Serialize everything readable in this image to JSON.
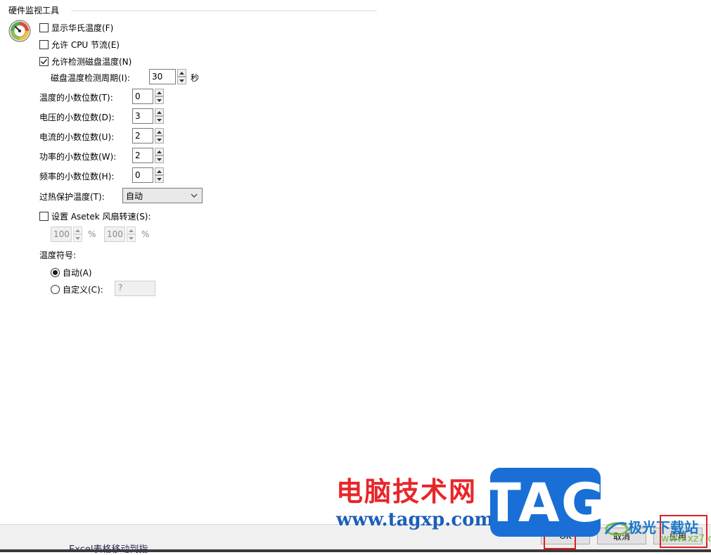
{
  "section": {
    "title": "硬件监视工具"
  },
  "options": {
    "fahrenheit": {
      "label": "显示华氏温度(F)",
      "checked": false
    },
    "cpu_throttle": {
      "label": "允许 CPU 节流(E)",
      "checked": false
    },
    "disk_temp": {
      "label": "允许检测磁盘温度(N)",
      "checked": true
    }
  },
  "disk_period": {
    "label": "磁盘温度检测周期(I):",
    "value": "30",
    "unit": "秒"
  },
  "decimals": [
    {
      "label": "温度的小数位数(T):",
      "value": "0"
    },
    {
      "label": "电压的小数位数(D):",
      "value": "3"
    },
    {
      "label": "电流的小数位数(U):",
      "value": "2"
    },
    {
      "label": "功率的小数位数(W):",
      "value": "2"
    },
    {
      "label": "频率的小数位数(H):",
      "value": "0"
    }
  ],
  "overheat": {
    "label": "过热保护温度(T):",
    "selected": "自动"
  },
  "asetek": {
    "label": "设置 Asetek 风扇转速(S):",
    "checked": false,
    "fan1": {
      "value": "100",
      "unit": "%"
    },
    "fan2": {
      "value": "100",
      "unit": "%"
    }
  },
  "temp_symbol": {
    "label": "温度符号:",
    "auto": {
      "label": "自动(A)",
      "selected": true
    },
    "custom": {
      "label": "自定义(C):",
      "selected": false,
      "value": "?"
    }
  },
  "buttons": {
    "ok": "OK",
    "cancel": "取消",
    "apply": "应用"
  },
  "background_text": "Excel表格移动到指",
  "watermark": {
    "cn": "电脑技术网",
    "url": "www.tagxp.com",
    "tag": "TAG",
    "jg": "极光下载站",
    "jg_url": "www.xz7.com"
  },
  "colors": {
    "accent_red": "#e02020",
    "watermark_red": "#e8262a",
    "watermark_blue": "#1a6fd6"
  }
}
